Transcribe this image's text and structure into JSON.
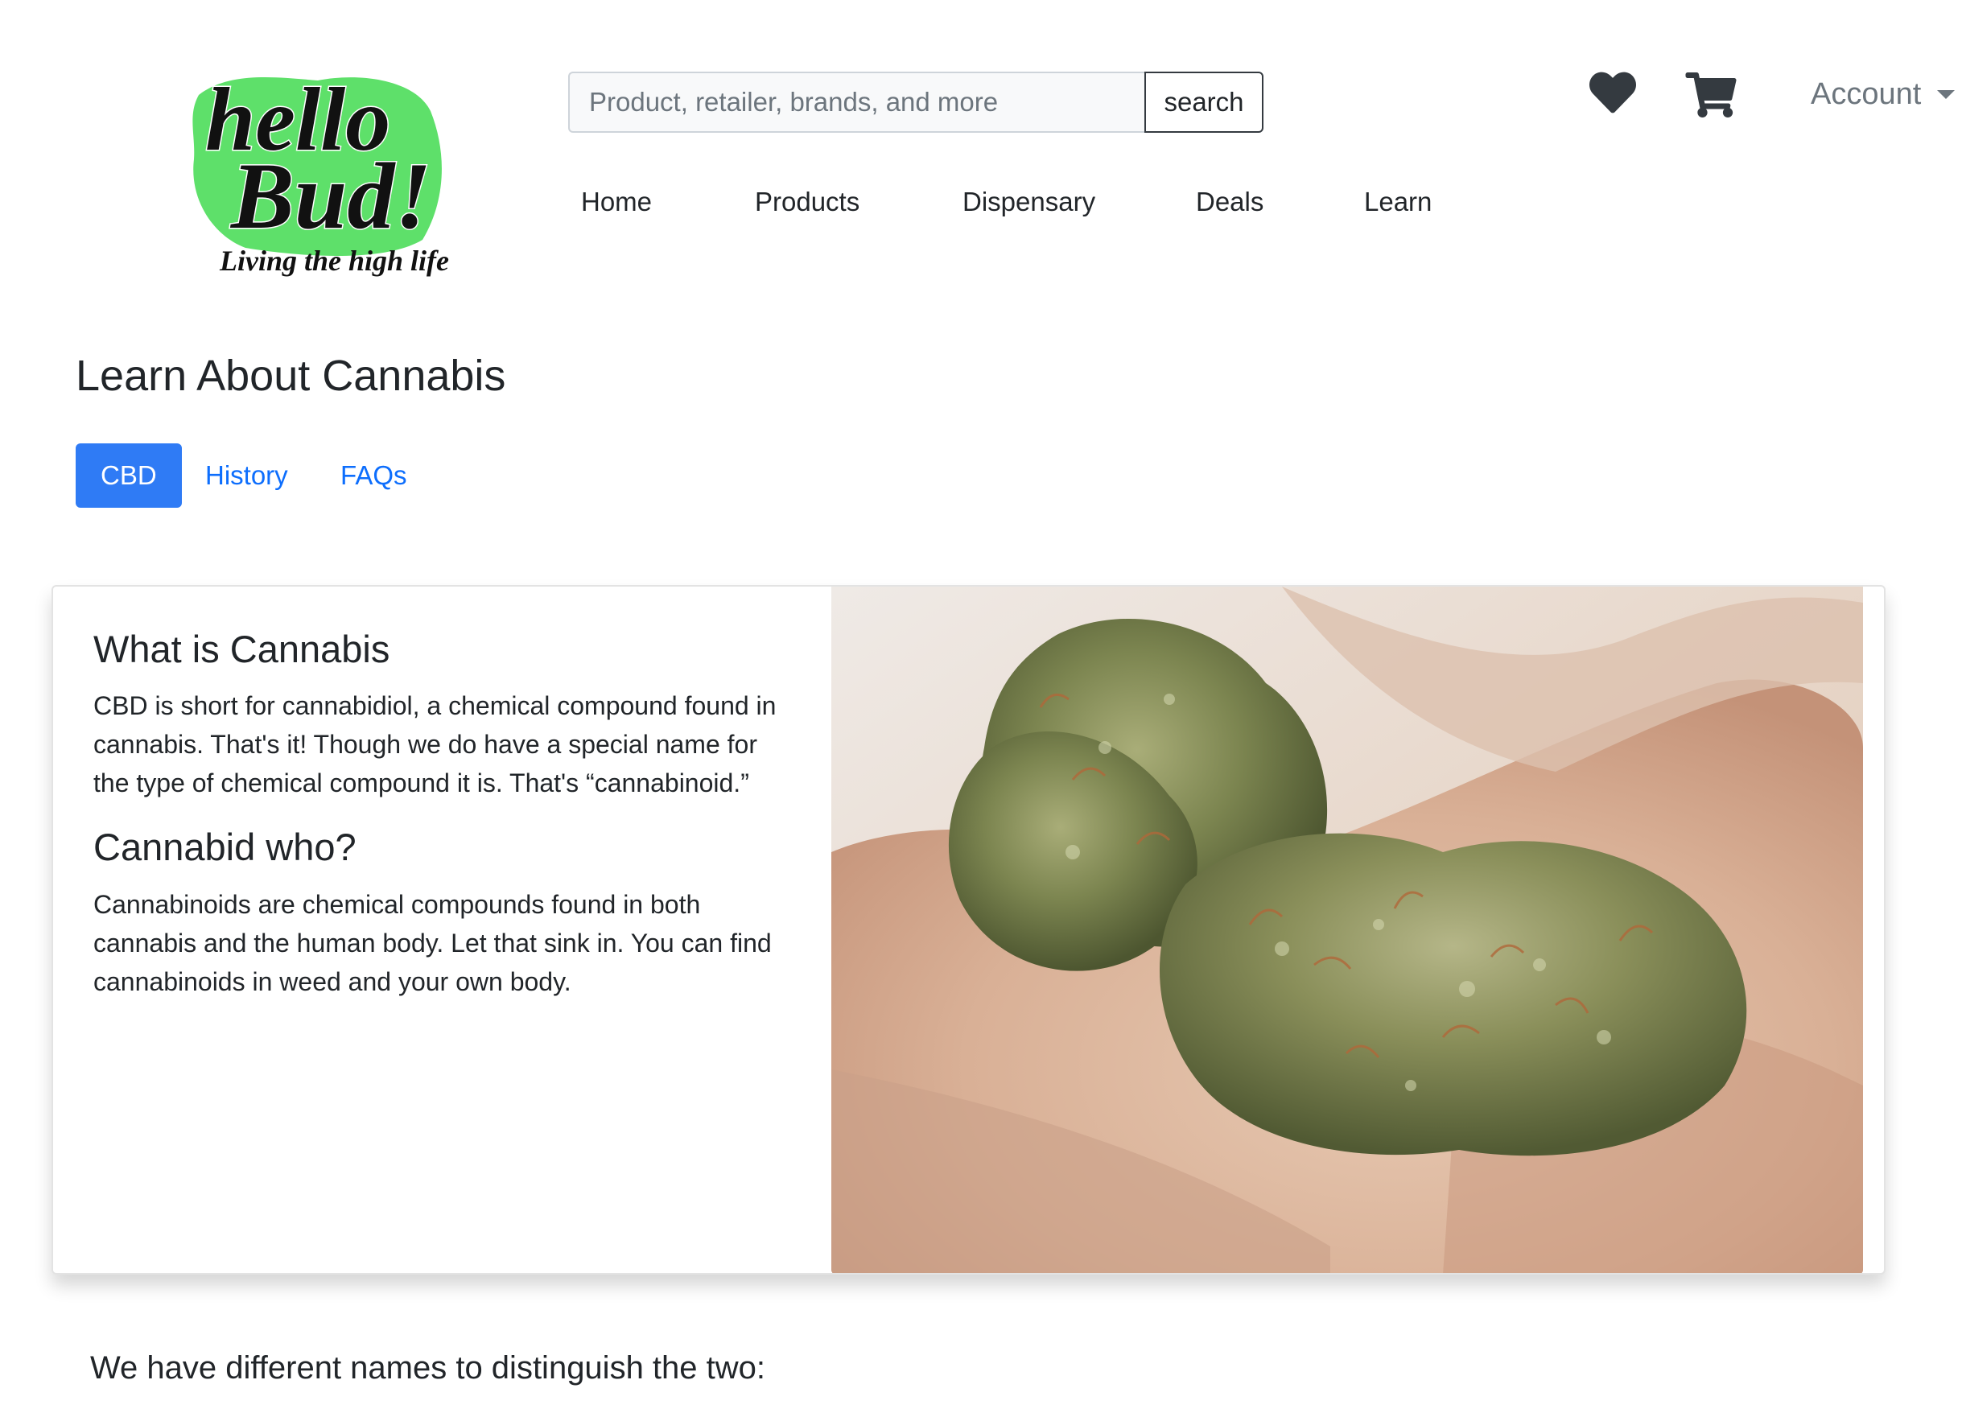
{
  "brand": {
    "logo_line1": "hello",
    "logo_line2": "Bud!",
    "tagline": "Living the high life",
    "accent_color": "#5ee06a"
  },
  "search": {
    "placeholder": "Product, retailer, brands, and more",
    "value": "",
    "button_label": "search"
  },
  "header": {
    "icons": [
      "heart-icon",
      "cart-icon"
    ],
    "account_label": "Account"
  },
  "nav": {
    "items": [
      {
        "label": "Home"
      },
      {
        "label": "Products"
      },
      {
        "label": "Dispensary"
      },
      {
        "label": "Deals"
      },
      {
        "label": "Learn"
      }
    ]
  },
  "page": {
    "title": "Learn About Cannabis"
  },
  "tabs": {
    "items": [
      {
        "label": "CBD",
        "active": true
      },
      {
        "label": "History",
        "active": false
      },
      {
        "label": "FAQs",
        "active": false
      }
    ],
    "active_color": "#2f7bf5",
    "link_color": "#0d6efd"
  },
  "card": {
    "heading1": "What is Cannabis",
    "paragraph1": "CBD is short for cannabidiol, a chemical compound found in cannabis. That's it! Though we do have a special name for the type of chemical compound it is. That's “cannabinoid.”",
    "heading2": "Cannabid who?",
    "paragraph2": "Cannabinoids are chemical compounds found in both cannabis and the human body. Let that sink in. You can find cannabinoids in weed and your own body."
  },
  "section": {
    "heading": "We have different names to distinguish the two:"
  }
}
